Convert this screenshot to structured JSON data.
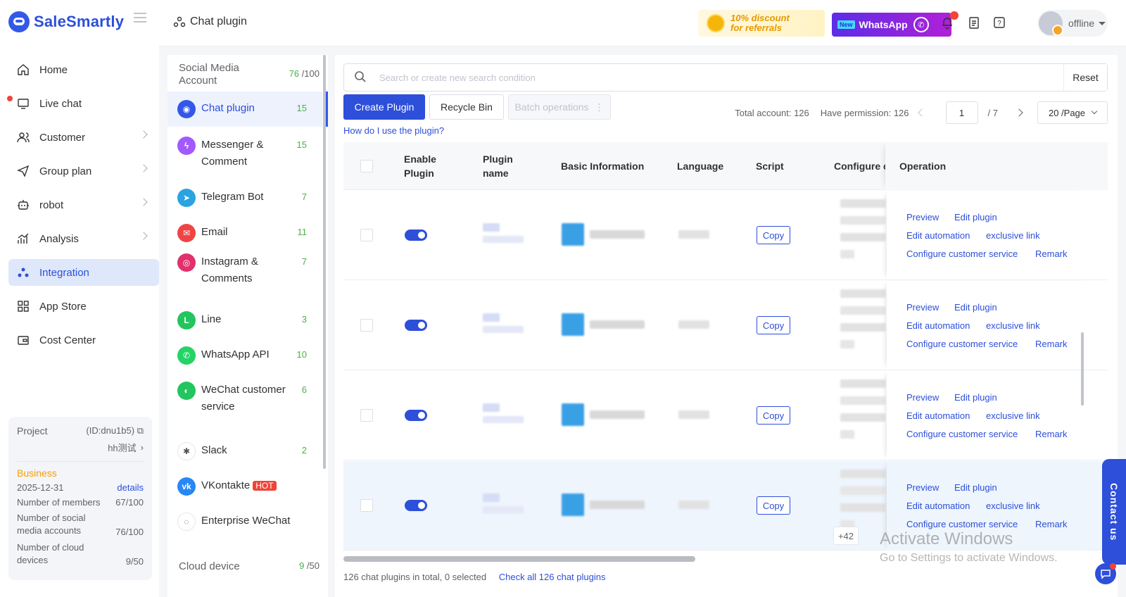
{
  "app": {
    "brand": "SaleSmartly"
  },
  "nav": {
    "items": [
      {
        "label": "Home",
        "icon": "home-icon",
        "has_chevron": false,
        "active": false
      },
      {
        "label": "Live chat",
        "icon": "chat-icon",
        "has_chevron": false,
        "active": false,
        "dot": true
      },
      {
        "label": "Customer",
        "icon": "users-icon",
        "has_chevron": true,
        "active": false
      },
      {
        "label": "Group plan",
        "icon": "send-icon",
        "has_chevron": true,
        "active": false
      },
      {
        "label": "robot",
        "icon": "robot-icon",
        "has_chevron": true,
        "active": false
      },
      {
        "label": "Analysis",
        "icon": "chart-icon",
        "has_chevron": true,
        "active": false
      },
      {
        "label": "Integration",
        "icon": "integration-icon",
        "has_chevron": false,
        "active": true
      },
      {
        "label": "App Store",
        "icon": "grid-icon",
        "has_chevron": false,
        "active": false
      },
      {
        "label": "Cost Center",
        "icon": "wallet-icon",
        "has_chevron": false,
        "active": false
      }
    ]
  },
  "project": {
    "label": "Project",
    "id": "(ID:dnu1b5)",
    "name": "hh测试",
    "plan": "Business",
    "expiry": "2025-12-31",
    "details_link": "details",
    "members_label": "Number of members",
    "members_value": "67/100",
    "social_label": "Number of social media accounts",
    "social_value": "76/100",
    "cloud_label": "Number of cloud devices",
    "cloud_value": "9/50"
  },
  "header": {
    "title": "Chat plugin",
    "promo_text_1": "10% discount",
    "promo_text_2": "for referrals",
    "promo2_new": "New",
    "promo2_label": "WhatsApp",
    "user_status": "offline"
  },
  "subnav": {
    "header_label": "Social Media Account",
    "header_count": "76",
    "header_total": "/100",
    "items": [
      {
        "label": "Chat plugin",
        "count": "15",
        "color": "#3358e8",
        "glyph": "◉",
        "active": true
      },
      {
        "label": "Messenger & Comment",
        "count": "15",
        "color": "#a259ff",
        "glyph": "ϟ",
        "active": false
      },
      {
        "label": "Telegram Bot",
        "count": "7",
        "color": "#2aa3e0",
        "glyph": "➤",
        "active": false
      },
      {
        "label": "Email",
        "count": "11",
        "color": "#ef4444",
        "glyph": "✉",
        "active": false
      },
      {
        "label": "Instagram & Comments",
        "count": "7",
        "color": "#e1306c",
        "glyph": "◎",
        "active": false
      },
      {
        "label": "Line",
        "count": "3",
        "color": "#22c55e",
        "glyph": "L",
        "active": false
      },
      {
        "label": "WhatsApp API",
        "count": "10",
        "color": "#25d366",
        "glyph": "✆",
        "active": false
      },
      {
        "label": "WeChat customer service",
        "count": "6",
        "color": "#22c55e",
        "glyph": "◐",
        "active": false
      },
      {
        "label": "Slack",
        "count": "2",
        "color": "#ffffff",
        "glyph": "✱",
        "active": false
      },
      {
        "label": "VKontakte",
        "count": "",
        "color": "#2787f5",
        "glyph": "vk",
        "active": false,
        "badge": "HOT"
      },
      {
        "label": "Enterprise WeChat",
        "count": "",
        "color": "#ffffff",
        "glyph": "◌",
        "active": false
      }
    ],
    "footer_label": "Cloud device",
    "footer_count": "9",
    "footer_total": "/50"
  },
  "main": {
    "search_placeholder": "Search or create new search condition",
    "reset_label": "Reset",
    "create_label": "Create Plugin",
    "recycle_label": "Recycle Bin",
    "batch_label": "Batch operations",
    "howto_label": "How do I use the plugin?",
    "total_label": "Total account:",
    "total_value": "126",
    "permission_label": "Have permission:",
    "permission_value": "126",
    "page_current": "1",
    "page_total": "/ 7",
    "page_size": "20 /Page"
  },
  "table": {
    "columns": [
      "Enable Plugin",
      "Plugin name",
      "Basic Information",
      "Language",
      "Script",
      "Configure c",
      "Operation"
    ],
    "copy_label": "Copy",
    "ops": [
      "Preview",
      "Edit plugin",
      "Edit automation",
      "exclusive link",
      "Configure customer service",
      "Remark"
    ],
    "rows": [
      {
        "enabled": true
      },
      {
        "enabled": true
      },
      {
        "enabled": true
      },
      {
        "enabled": true,
        "highlight": true
      }
    ],
    "more_badge": "+42",
    "footer_summary": "126 chat plugins in total, 0 selected",
    "footer_link": "Check all 126 chat plugins"
  },
  "overlay": {
    "watermark_1": "Activate Windows",
    "watermark_2": "Go to Settings to activate Windows.",
    "contact_label": "Contact us"
  }
}
